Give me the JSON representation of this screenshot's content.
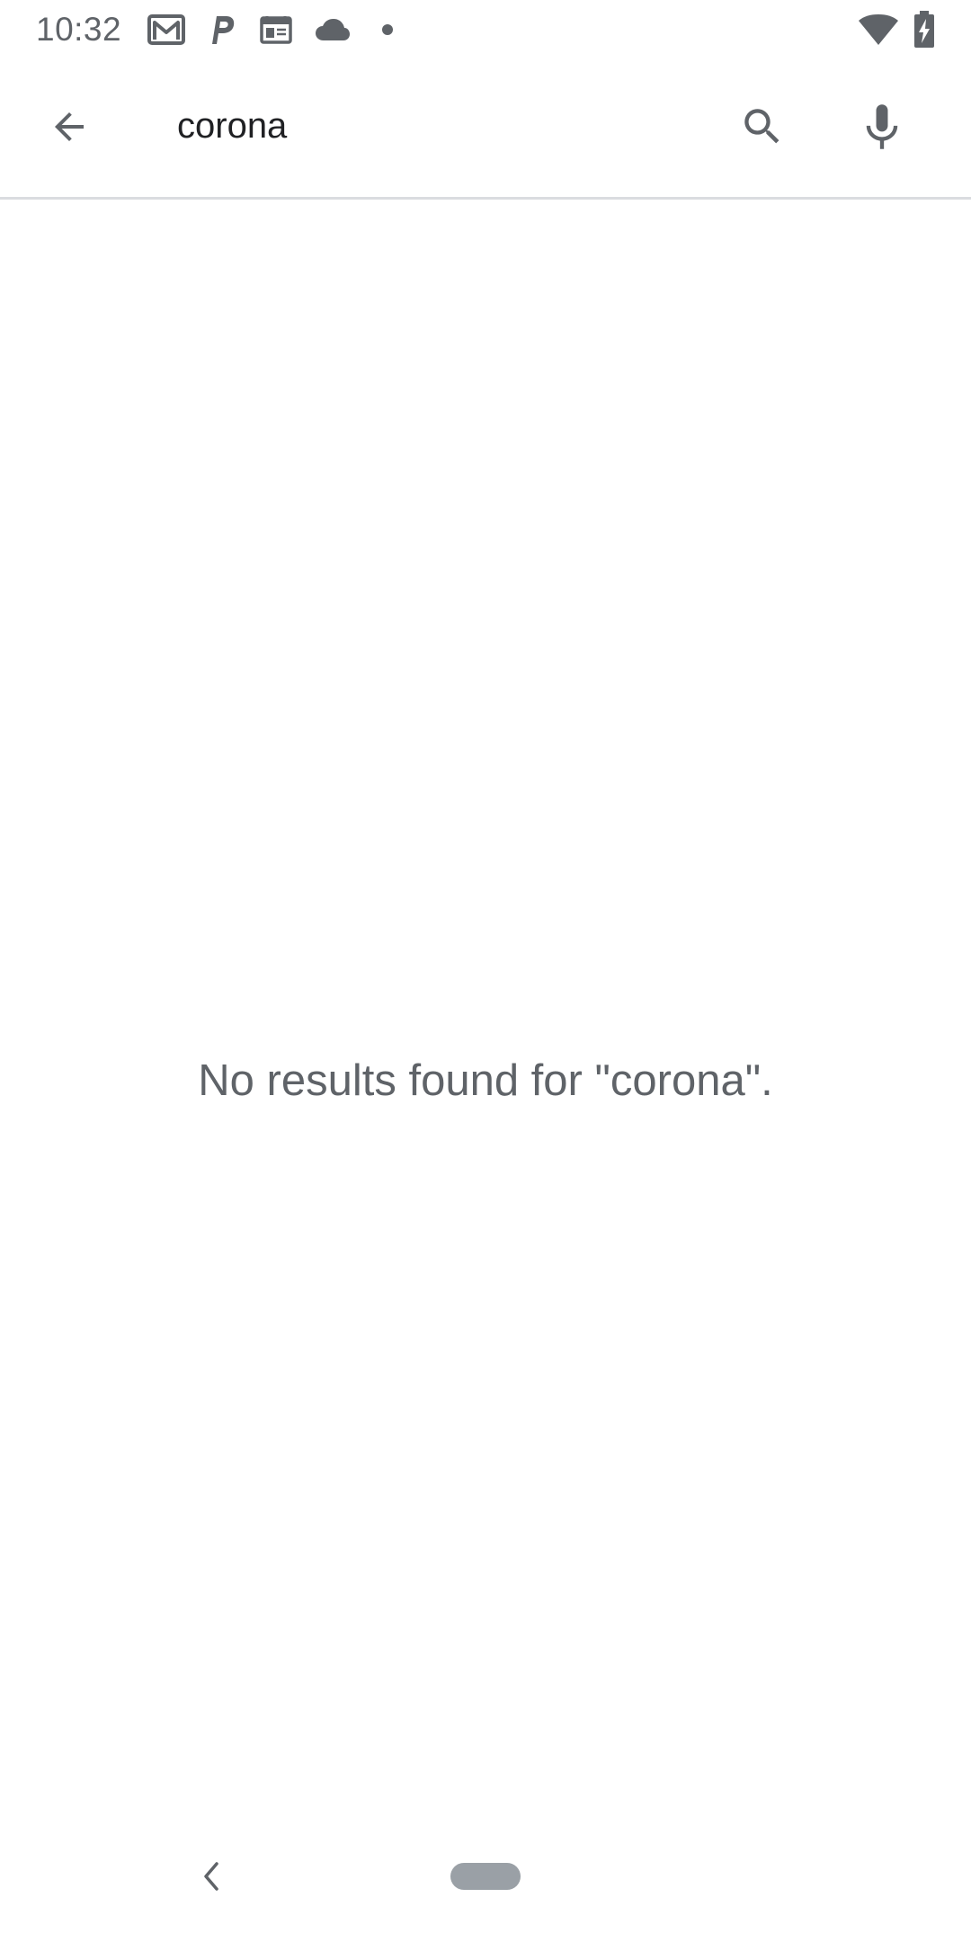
{
  "status_bar": {
    "time": "10:32",
    "notification_icons": [
      "gmail-icon",
      "parking-icon",
      "calendar-icon",
      "cloud-icon",
      "more-dot-icon"
    ],
    "system_icons": [
      "wifi-icon",
      "battery-charging-icon"
    ]
  },
  "toolbar": {
    "search_query": "corona",
    "icons": [
      "back-arrow-icon",
      "search-icon",
      "microphone-icon"
    ]
  },
  "results": {
    "empty_message": "No results found for \"corona\"."
  },
  "nav_bar": {
    "icons": [
      "nav-back-icon",
      "home-pill"
    ]
  },
  "colors": {
    "icon_gray": "#5f6368",
    "divider": "#dadce0",
    "home_pill": "#9aa0a6",
    "background": "#ffffff"
  }
}
